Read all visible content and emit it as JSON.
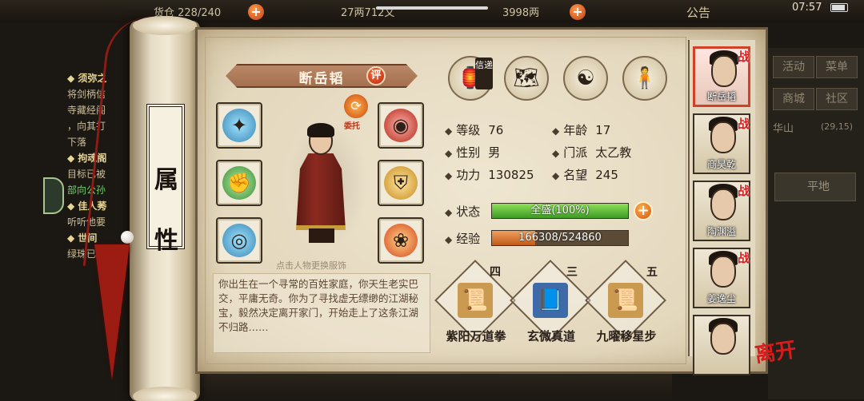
{
  "status_bar": {
    "time": "07:57"
  },
  "top_bar": {
    "res1": "货仓 228/240",
    "res2": "27两712文",
    "res3": "3998两",
    "notice": "公告"
  },
  "left_log": [
    {
      "text": "◆ 须弥之",
      "cls": "head"
    },
    {
      "text": "将剑柄信",
      "cls": ""
    },
    {
      "text": "寺藏经阁",
      "cls": ""
    },
    {
      "text": "，向其打",
      "cls": ""
    },
    {
      "text": "下落",
      "cls": ""
    },
    {
      "text": "◆ 拘魂阁",
      "cls": "head"
    },
    {
      "text": "目标已被",
      "cls": ""
    },
    {
      "text": "部向公孙",
      "cls": "green"
    },
    {
      "text": "◆ 佳人莠",
      "cls": "head"
    },
    {
      "text": "听听他要",
      "cls": ""
    },
    {
      "text": "◆ 世间",
      "cls": "head"
    },
    {
      "text": "绿珠已",
      "cls": ""
    }
  ],
  "right_panel": {
    "b1": "活动",
    "b2": "菜单",
    "b3": "商城",
    "b4": "社区",
    "location": "华山",
    "coord": "(29,15)",
    "terrain": "平地"
  },
  "scroll_title": [
    "属",
    "性"
  ],
  "character": {
    "name": "断岳韬",
    "rate": "评",
    "trust_label": "委托",
    "change_hint": "点击人物更换服饰",
    "description": "你出生在一个寻常的百姓家庭，你天生老实巴交，平庸无奇。你为了寻找虚无缥缈的江湖秘宝，毅然决定离开家门，开始走上了这条江湖不归路……"
  },
  "letter_tag": "信递",
  "stats": {
    "level_label": "等级",
    "level": "76",
    "age_label": "年龄",
    "age": "17",
    "gender_label": "性别",
    "gender": "男",
    "sect_label": "门派",
    "sect": "太乙教",
    "power_label": "功力",
    "power": "130825",
    "fame_label": "名望",
    "fame": "245",
    "state_label": "状态",
    "state_text": "全盛(100%)",
    "state_fraction": 1.0,
    "exp_label": "经验",
    "exp_text": "166308/524860",
    "exp_fraction": 0.317
  },
  "skills": [
    {
      "num": "四",
      "name": "紫阳万道拳"
    },
    {
      "num": "三",
      "name": "玄微真道"
    },
    {
      "num": "五",
      "name": "九曜移星步"
    }
  ],
  "disciples": [
    {
      "name": "断岳韬",
      "selected": true,
      "battle": "战"
    },
    {
      "name": "商昊乾",
      "selected": false,
      "battle": "战"
    },
    {
      "name": "陶渊溢",
      "selected": false,
      "battle": "战"
    },
    {
      "name": "姜逸尘",
      "selected": false,
      "battle": "战"
    },
    {
      "name": "",
      "selected": false,
      "battle": ""
    }
  ],
  "leave_button": "离开"
}
